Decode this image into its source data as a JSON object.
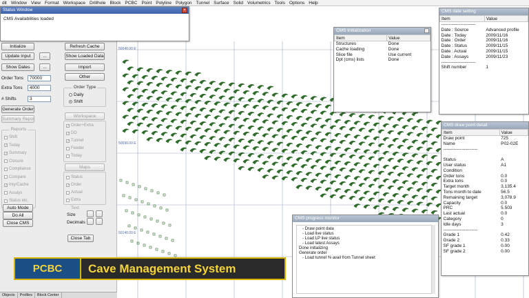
{
  "menu": [
    "dit",
    "Window",
    "View",
    "Format",
    "Workspace",
    "Drillhole",
    "Block",
    "PCBC",
    "Point",
    "Polyline",
    "Polygon",
    "Tunnel",
    "Surface",
    "Solid",
    "Volumetrics",
    "Tools",
    "Options",
    "Help"
  ],
  "status_window": {
    "title": "Status Window",
    "message": "CMS Availabilities loaded"
  },
  "panel": {
    "initialize": "Initialize",
    "refresh_cache": "Refresh Cache",
    "update_input": "Update Input",
    "show_loaded_data": "Show Loaded Data",
    "show_dates": "Show Dates",
    "import": "Import",
    "other": "Other",
    "ellipsis": "...",
    "order_tons_label": "Order Tons",
    "order_tons_value": "70000",
    "extra_tons_label": "Extra Tons",
    "extra_tons_value": "4000",
    "shifts_label": "# Shifts",
    "shifts_value": "3",
    "order_type_title": "Order Type",
    "order_type_daily": "Daily",
    "order_type_shift": "Shift",
    "generate_order": "Generate Order",
    "summary_report": "Summary Report",
    "workspace": "Workspace",
    "reports_title": "Reports",
    "reports": [
      "Shift",
      "Today",
      "Summary",
      "Closure",
      "Compliance",
      "Compare",
      "Inty/Cache",
      "Assays",
      "Status etc."
    ],
    "workspace_checks": [
      "Order+Extra",
      "DD",
      "Tunnel",
      "Feeder",
      "Today"
    ],
    "maps": "Maps",
    "maps_checks": [
      "Status",
      "Order",
      "Actual",
      "Extra"
    ],
    "text_title": "Text",
    "size_label": "Size",
    "decimals_label": "Decimals",
    "auto_mode": "Auto Mode",
    "do_all": "Do All",
    "close_cms": "Close CMS",
    "close_tab": "Close Tab"
  },
  "tabs": [
    "Objects",
    "Profiles",
    "Block Center"
  ],
  "cms_init": {
    "title": "CMS Initialization",
    "headers": [
      "Item",
      "Value"
    ],
    "rows": [
      [
        "Structures",
        "Done"
      ],
      [
        "Cache loading",
        "Done"
      ],
      [
        "Slice file",
        "Use current"
      ],
      [
        "Dpt (cms) lists",
        "Done"
      ]
    ]
  },
  "cms_date": {
    "title": "CMS date setting",
    "headers": [
      "Item",
      "Value"
    ],
    "rows": [
      [
        "-----------------------",
        ""
      ],
      [
        "Date : Source",
        "Advanced profile"
      ],
      [
        "Date : Today",
        "2009/11/16"
      ],
      [
        "Date : Order",
        "2009/11/16"
      ],
      [
        "Date : Status",
        "2009/11/15"
      ],
      [
        "Date : Actual",
        "2009/11/15"
      ],
      [
        "Date : Assays",
        "2009/11/23"
      ],
      [
        "-----------------------",
        ""
      ],
      [
        "Shift number",
        "1"
      ]
    ]
  },
  "cms_draw": {
    "title": "CMS draw point detail",
    "headers": [
      "Item",
      "Value"
    ],
    "rows": [
      [
        "Draw point",
        "725"
      ],
      [
        "Name",
        "P02-02E"
      ],
      [
        "-----------------------",
        ""
      ],
      [
        "",
        ""
      ],
      [
        "Status",
        "A"
      ],
      [
        "User status",
        "A1"
      ],
      [
        "Condition",
        ""
      ],
      [
        "Order tons",
        "0.0"
      ],
      [
        "Extra tons",
        "0.0"
      ],
      [
        "Target month",
        "3,135.4"
      ],
      [
        "Tons month to date",
        "56.5"
      ],
      [
        "Remaining target",
        "3,078.9"
      ],
      [
        "Capacity",
        "0.0"
      ],
      [
        "PRC",
        "5.503"
      ],
      [
        "Last actual",
        "0.0"
      ],
      [
        "Category",
        "0"
      ],
      [
        "Idle days",
        "3"
      ],
      [
        "-----------------------",
        ""
      ],
      [
        "Grade 1",
        "0.42"
      ],
      [
        "Grade 2",
        "0.33"
      ],
      [
        "SF grade 1",
        "0.00"
      ],
      [
        "SF grade 2",
        "0.00"
      ]
    ]
  },
  "cms_progress": {
    "title": "CMS progress monitor",
    "lines": [
      "- Draw point data",
      "- Load live status",
      "- Load LP live status",
      "- Load latest Assays",
      "Done initializing",
      "Generate order",
      "- Load tunnel % avail from Tunnel sheet"
    ]
  },
  "banner": {
    "left": "PCBC",
    "right": "Cave Management System"
  },
  "canvas_labels": [
    "50040.00 E",
    "50090.00 E",
    "50140.00 E"
  ],
  "colors": {
    "stroke": "#2f6b2a",
    "grid": "#9aa8c6",
    "accent": "#d7b400"
  }
}
